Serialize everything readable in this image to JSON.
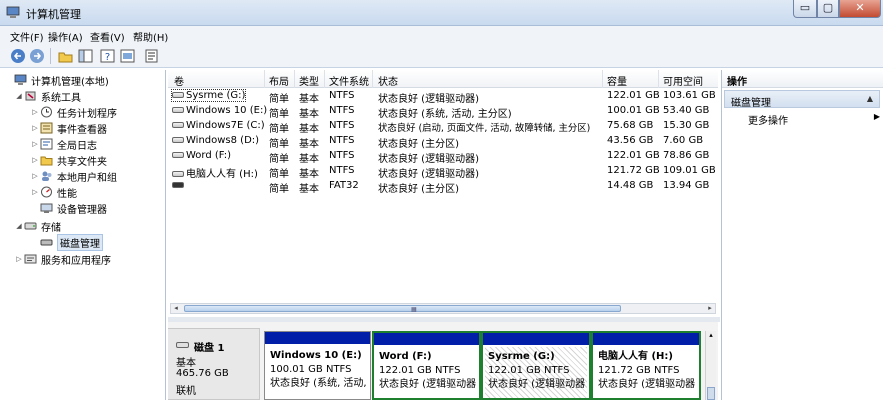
{
  "window": {
    "title": "计算机管理",
    "min_label": "▭",
    "max_label": "▢",
    "close_label": "✕"
  },
  "menu": [
    "文件(F)",
    "操作(A)",
    "查看(V)",
    "帮助(H)"
  ],
  "tree": {
    "root": "计算机管理(本地)",
    "system_tools": "系统工具",
    "items": [
      "任务计划程序",
      "事件查看器",
      "全局日志",
      "共享文件夹",
      "本地用户和组",
      "性能",
      "设备管理器"
    ],
    "storage": "存储",
    "disk_mgmt": "磁盘管理",
    "services": "服务和应用程序"
  },
  "volumes": {
    "headers": [
      "卷",
      "布局",
      "类型",
      "文件系统",
      "状态",
      "容量",
      "可用空间"
    ],
    "rows": [
      {
        "name": "Sysrme (G:)",
        "layout": "简单",
        "type": "基本",
        "fs": "NTFS",
        "status": "状态良好 (逻辑驱动器)",
        "capacity": "122.01 GB",
        "free": "103.61 GB"
      },
      {
        "name": "Windows 10 (E:)",
        "layout": "简单",
        "type": "基本",
        "fs": "NTFS",
        "status": "状态良好 (系统, 活动, 主分区)",
        "capacity": "100.01 GB",
        "free": "53.40 GB"
      },
      {
        "name": "Windows7E (C:)",
        "layout": "简单",
        "type": "基本",
        "fs": "NTFS",
        "status": "状态良好 (启动, 页面文件, 活动, 故障转储, 主分区)",
        "capacity": "75.68 GB",
        "free": "15.30 GB"
      },
      {
        "name": "Windows8 (D:)",
        "layout": "简单",
        "type": "基本",
        "fs": "NTFS",
        "status": "状态良好 (主分区)",
        "capacity": "43.56 GB",
        "free": "7.60 GB"
      },
      {
        "name": "Word (F:)",
        "layout": "简单",
        "type": "基本",
        "fs": "NTFS",
        "status": "状态良好 (逻辑驱动器)",
        "capacity": "122.01 GB",
        "free": "78.86 GB"
      },
      {
        "name": "电脑人人有 (H:)",
        "layout": "简单",
        "type": "基本",
        "fs": "NTFS",
        "status": "状态良好 (逻辑驱动器)",
        "capacity": "121.72 GB",
        "free": "109.01 GB"
      },
      {
        "name": "",
        "layout": "简单",
        "type": "基本",
        "fs": "FAT32",
        "status": "状态良好 (主分区)",
        "capacity": "14.48 GB",
        "free": "13.94 GB"
      }
    ]
  },
  "disk": {
    "name": "磁盘 1",
    "type": "基本",
    "size": "465.76 GB",
    "state": "联机",
    "partitions": [
      {
        "name": "Windows 10 (E:)",
        "size": "100.01 GB NTFS",
        "status": "状态良好 (系统, 活动,"
      },
      {
        "name": "Word (F:)",
        "size": "122.01 GB NTFS",
        "status": "状态良好 (逻辑驱动器)"
      },
      {
        "name": "Sysrme (G:)",
        "size": "122.01 GB NTFS",
        "status": "状态良好 (逻辑驱动器"
      },
      {
        "name": "电脑人人有 (H:)",
        "size": "121.72 GB NTFS",
        "status": "状态良好 (逻辑驱动器"
      }
    ]
  },
  "actions": {
    "header": "操作",
    "section": "磁盘管理",
    "more": "更多操作"
  },
  "colors": {
    "partition_bar": "#001ea8",
    "selection_green": "#1e7f2e",
    "title_gradient_top": "#dfe9f5"
  }
}
